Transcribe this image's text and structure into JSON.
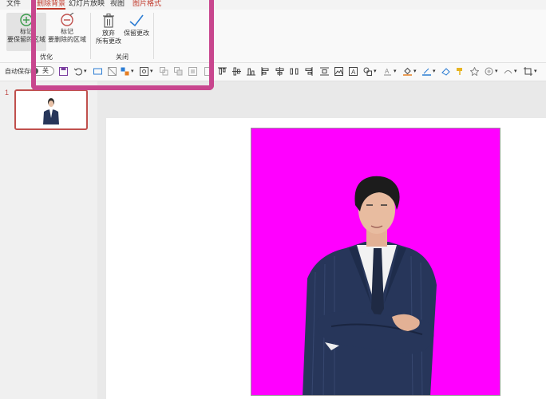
{
  "menu": {
    "file": "文件",
    "bg_removal": "删除背景",
    "tab3": "幻灯片放映",
    "view": "视图",
    "picture_format": "图片格式"
  },
  "ribbon": {
    "mark_keep": [
      "标记",
      "要保留的区域"
    ],
    "mark_remove": [
      "标记",
      "要删除的区域"
    ],
    "discard": [
      "放弃",
      "所有更改"
    ],
    "keep_changes": "保留更改",
    "group_refine": "优化",
    "group_close": "关闭"
  },
  "toolbar": {
    "autosave_label": "自动保存",
    "autosave_state": "关"
  },
  "slides": {
    "current_number": "1"
  },
  "colors": {
    "highlight": "#c8468e",
    "photo_background": "#ff00ff",
    "thumb_border": "#c0504d",
    "check": "#2b7cd3"
  }
}
